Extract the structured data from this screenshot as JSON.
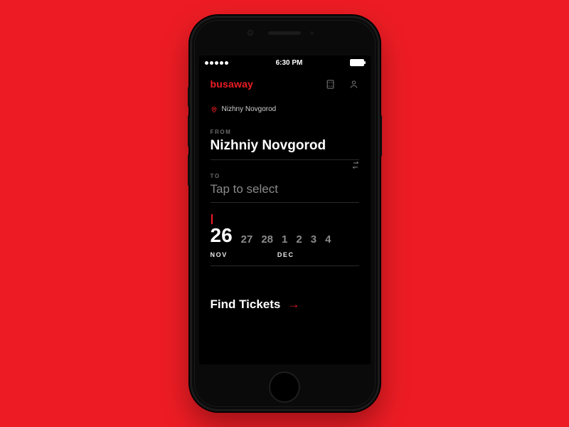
{
  "status": {
    "time": "6:30 PM"
  },
  "brand": "busaway",
  "location": {
    "label": "Nizhny Novgorod"
  },
  "from": {
    "heading": "FROM",
    "value": "Nizhniy Novgorod"
  },
  "to": {
    "heading": "TO",
    "placeholder": "Tap to select"
  },
  "dates": {
    "selected": "26",
    "rest": [
      "27",
      "28",
      "1",
      "2",
      "3",
      "4"
    ],
    "month1": "NOV",
    "month2": "DEC"
  },
  "cta": {
    "label": "Find Tickets",
    "arrow": "→"
  }
}
